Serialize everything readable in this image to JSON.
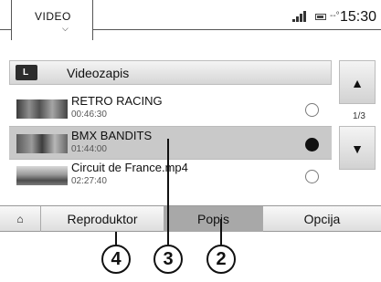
{
  "status_bar": {
    "title": "VIDEO",
    "temperature": "--°",
    "clock": "15:30",
    "signal_icon": "signal-bars-icon",
    "battery_icon": "battery-icon"
  },
  "header": {
    "folder_label": "Videozapis",
    "folder_icon": "folder-up-icon",
    "folder_icon_glyph": "L"
  },
  "list": {
    "items": [
      {
        "title": "RETRO RACING",
        "duration": "00:46:30",
        "selected": false
      },
      {
        "title": "BMX BANDITS",
        "duration": "01:44:00",
        "selected": true
      },
      {
        "title": "Circuit de France.mp4",
        "duration": "02:27:40",
        "selected": false
      }
    ]
  },
  "pager": {
    "up_glyph": "▲",
    "down_glyph": "▼",
    "page_indicator": "1/3"
  },
  "tabs": {
    "home_glyph": "⌂",
    "home_icon": "home-icon",
    "reproduktor": "Reproduktor",
    "popis": "Popis",
    "opcija": "Opcija",
    "active": "Popis"
  },
  "callouts": {
    "c4": "4",
    "c3": "3",
    "c2": "2"
  },
  "colors": {
    "active_tab": "#a8a8a8",
    "selected_row": "#c9c9c9"
  }
}
